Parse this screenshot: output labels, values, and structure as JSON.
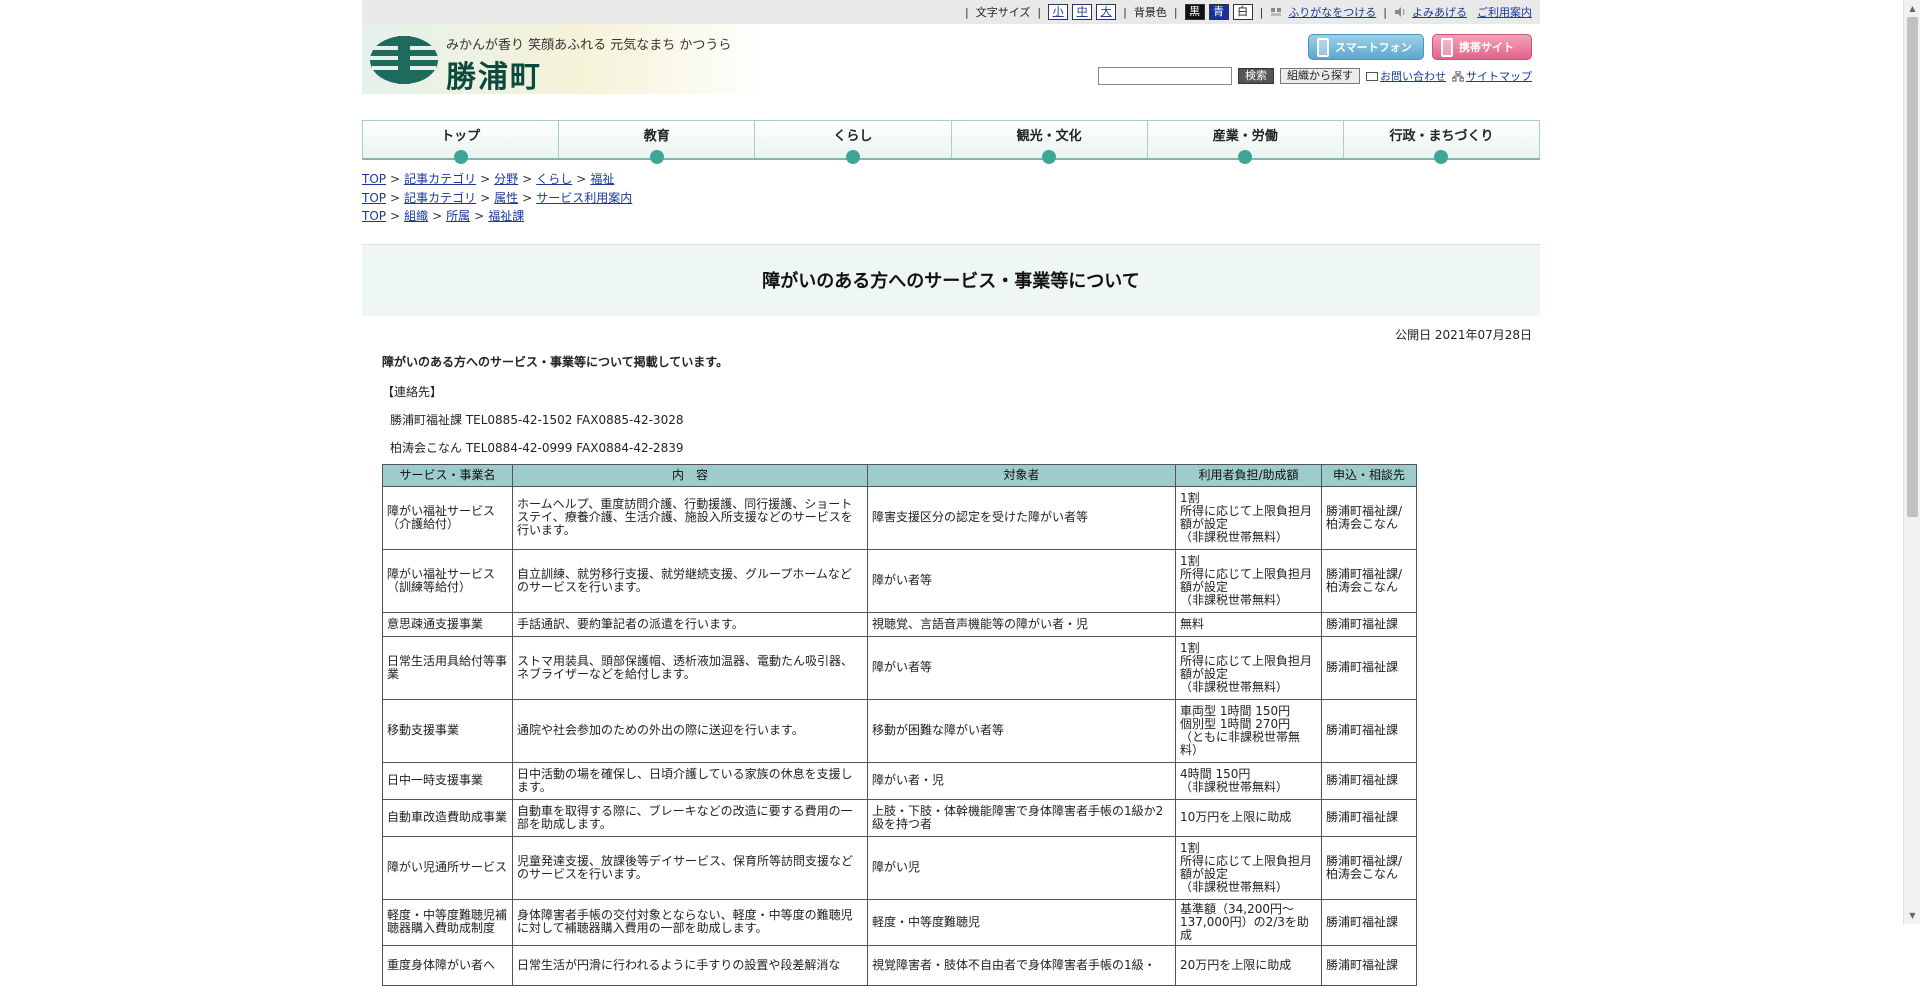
{
  "util": {
    "textsize_label": "文字サイズ",
    "size_small": "小",
    "size_medium": "中",
    "size_large": "大",
    "bg_label": "背景色",
    "bg_black": "黒",
    "bg_blue": "青",
    "bg_white": "白",
    "furigana": "ふりがなをつける",
    "readaloud": "よみあげる",
    "guide": "ご利用案内"
  },
  "header": {
    "catchphrase": "みかんが香り 笑顔あふれる 元気なまち かつうら",
    "town_name": "勝浦町",
    "smartphone_site": "スマートフォンサイト",
    "mobile_site": "携帯サイト",
    "search_button": "検索",
    "search_value": "",
    "org_button": "組織から探す",
    "contact": "お問い合わせ",
    "sitemap": "サイトマップ"
  },
  "gnav": [
    "トップ",
    "教育",
    "くらし",
    "観光・文化",
    "産業・労働",
    "行政・まちづくり"
  ],
  "breadcrumbs": [
    [
      "TOP",
      "記事カテゴリ",
      "分野",
      "くらし",
      "福祉"
    ],
    [
      "TOP",
      "記事カテゴリ",
      "属性",
      "サービス利用案内"
    ],
    [
      "TOP",
      "組織",
      "所属",
      "福祉課"
    ]
  ],
  "page": {
    "title": "障がいのある方へのサービス・事業等について",
    "pubdate": "公開日 2021年07月28日",
    "lead": "障がいのある方へのサービス・事業等について掲載しています。",
    "contact_title": "【連絡先】",
    "contact_1": "勝浦町福祉課 TEL0885-42-1502 FAX0885-42-3028",
    "contact_2": "柏涛会こなん TEL0884-42-0999 FAX0884-42-2839"
  },
  "table": {
    "headers": [
      "サービス・事業名",
      "内　容",
      "対象者",
      "利用者負担/助成額",
      "申込・相談先"
    ],
    "rows": [
      [
        "障がい福祉サービス（介護給付）",
        "ホームヘルプ、重度訪問介護、行動援護、同行援護、ショートステイ、療養介護、生活介護、施設入所支援などのサービスを行います。",
        "障害支援区分の認定を受けた障がい者等",
        "1割\n所得に応じて上限負担月額が設定\n（非課税世帯無料）",
        "勝浦町福祉課/柏涛会こなん"
      ],
      [
        "障がい福祉サービス（訓練等給付）",
        "自立訓練、就労移行支援、就労継続支援、グループホームなどのサービスを行います。",
        "障がい者等",
        "1割\n所得に応じて上限負担月額が設定\n（非課税世帯無料）",
        "勝浦町福祉課/柏涛会こなん"
      ],
      [
        "意思疎通支援事業",
        "手話通訳、要約筆記者の派遣を行います。",
        "視聴覚、言語音声機能等の障がい者・児",
        "無料",
        "勝浦町福祉課"
      ],
      [
        "日常生活用具給付等事業",
        "ストマ用装具、頭部保護帽、透析液加温器、電動たん吸引器、ネブライザーなどを給付します。",
        "障がい者等",
        "1割\n所得に応じて上限負担月額が設定\n（非課税世帯無料）",
        "勝浦町福祉課"
      ],
      [
        "移動支援事業",
        "通院や社会参加のための外出の際に送迎を行います。",
        "移動が困難な障がい者等",
        "車両型 1時間 150円\n個別型 1時間 270円\n（ともに非課税世帯無料）",
        "勝浦町福祉課"
      ],
      [
        "日中一時支援事業",
        "日中活動の場を確保し、日頃介護している家族の休息を支援します。",
        "障がい者・児",
        "4時間 150円\n（非課税世帯無料）",
        "勝浦町福祉課"
      ],
      [
        "自動車改造費助成事業",
        "自動車を取得する際に、ブレーキなどの改造に要する費用の一部を助成します。",
        "上肢・下肢・体幹機能障害で身体障害者手帳の1級か2級を持つ者",
        "10万円を上限に助成",
        "勝浦町福祉課"
      ],
      [
        "障がい児通所サービス",
        "児童発達支援、放課後等デイサービス、保育所等訪問支援などのサービスを行います。",
        "障がい児",
        "1割\n所得に応じて上限負担月額が設定\n（非課税世帯無料）",
        "勝浦町福祉課/柏涛会こなん"
      ],
      [
        "軽度・中等度難聴児補聴器購入費助成制度",
        "身体障害者手帳の交付対象とならない、軽度・中等度の難聴児に対して補聴器購入費用の一部を助成します。",
        "軽度・中等度難聴児",
        "基準額（34,200円～137,000円）の2/3を助成",
        "勝浦町福祉課"
      ],
      [
        "重度身体障がい者へ",
        "日常生活が円滑に行われるように手すりの設置や段差解消な",
        "視覚障害者・肢体不自由者で身体障害者手帳の1級・",
        "20万円を上限に助成",
        "勝浦町福祉課"
      ]
    ]
  },
  "colors": {
    "table_header_bg": "#9ecbcb",
    "nav_accent": "#3ea695",
    "title_bg": "#eef7f6",
    "link": "#1a3a9a"
  }
}
